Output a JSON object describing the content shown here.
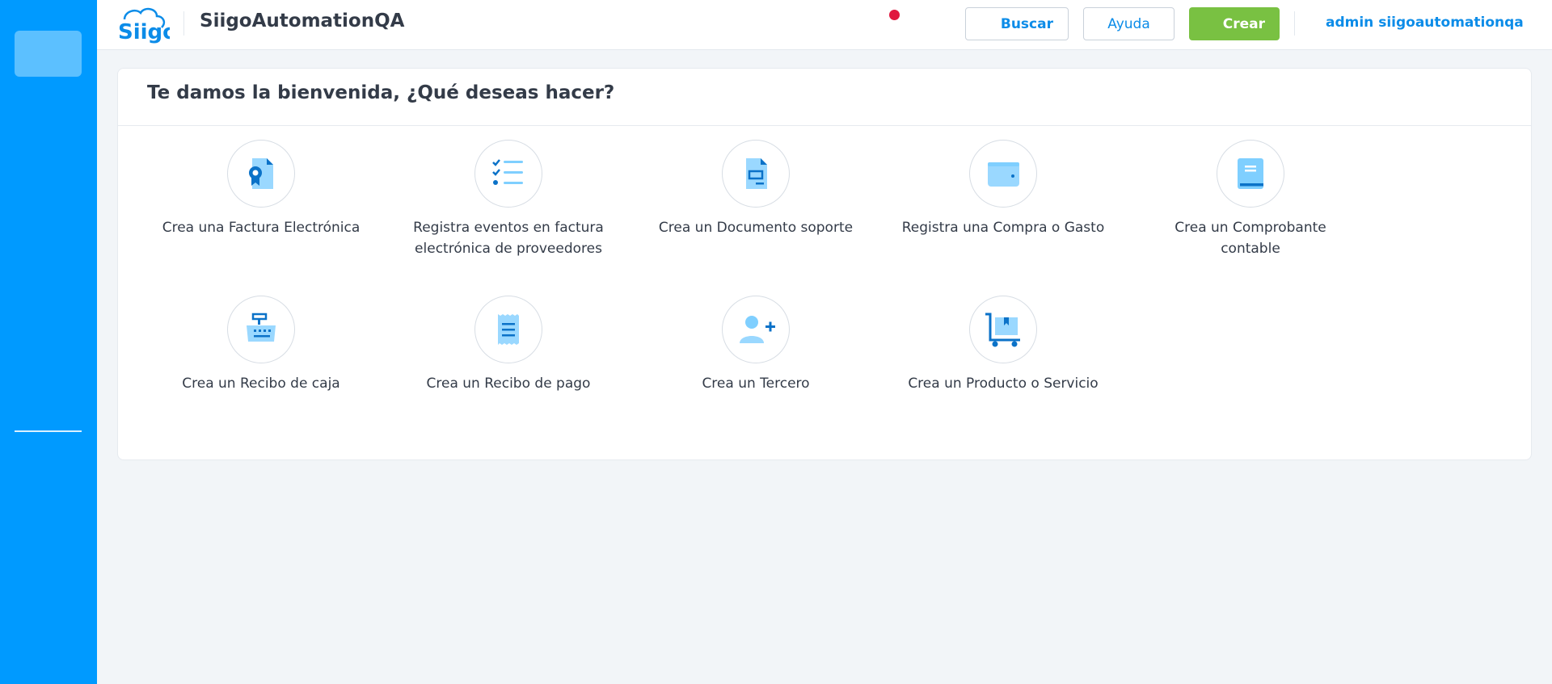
{
  "app": {
    "company_name": "SiigoAutomationQA",
    "logo_text": "Siigo"
  },
  "header": {
    "search_label": "Buscar",
    "help_label": "Ayuda",
    "create_label": "Crear",
    "user_name": "admin siigoautomationqa"
  },
  "main": {
    "welcome_title": "Te damos la bienvenida, ¿Qué deseas hacer?",
    "actions": [
      {
        "label": "Crea una Factura Electrónica",
        "icon": "certified-document-icon"
      },
      {
        "label": "Registra eventos en factura electrónica de proveedores",
        "icon": "checklist-icon"
      },
      {
        "label": "Crea un Documento soporte",
        "icon": "support-document-icon"
      },
      {
        "label": "Registra una Compra o Gasto",
        "icon": "wallet-icon"
      },
      {
        "label": "Crea un Comprobante contable",
        "icon": "ledger-book-icon"
      },
      {
        "label": "Crea un Recibo de caja",
        "icon": "cash-register-icon"
      },
      {
        "label": "Crea un Recibo de pago",
        "icon": "receipt-icon"
      },
      {
        "label": "Crea un Tercero",
        "icon": "add-user-icon"
      },
      {
        "label": "Crea un Producto o Servicio",
        "icon": "cart-box-icon"
      }
    ]
  },
  "colors": {
    "sidebar": "#009aff",
    "brand_blue": "#0c8ce8",
    "create_green": "#79c142",
    "notification": "#e0173f",
    "icon_light": "#7fcfff",
    "icon_dark": "#0b72c8"
  }
}
